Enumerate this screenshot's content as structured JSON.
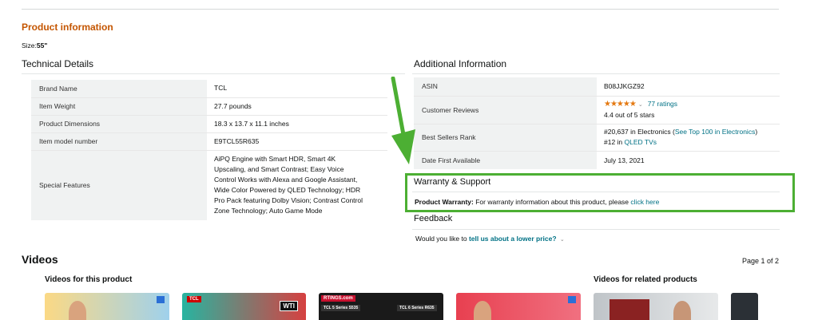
{
  "product_info": {
    "heading": "Product information",
    "size_label": "Size:",
    "size_value": "55\""
  },
  "technical_details": {
    "heading": "Technical Details",
    "rows": [
      {
        "key": "Brand Name",
        "value": "TCL"
      },
      {
        "key": "Item Weight",
        "value": "27.7 pounds"
      },
      {
        "key": "Product Dimensions",
        "value": "18.3 x 13.7 x 11.1 inches"
      },
      {
        "key": "Item model number",
        "value": "E9TCL55R635"
      },
      {
        "key": "Special Features",
        "value_lines": [
          "AiPQ Engine with Smart HDR, Smart 4K",
          "Upscaling, and Smart Contrast; Easy Voice",
          "Control Works with Alexa and Google Assistant,",
          "Wide Color Powered by QLED Technology; HDR",
          "Pro Pack featuring Dolby Vision; Contrast Control",
          "Zone Technology; Auto Game Mode"
        ]
      }
    ]
  },
  "additional_info": {
    "heading": "Additional Information",
    "asin_key": "ASIN",
    "asin_value": "B08JJKGZ92",
    "reviews_key": "Customer Reviews",
    "stars": "★★★★★",
    "rating_count": "77 ratings",
    "rating_text": "4.4 out of 5 stars",
    "rank_key": "Best Sellers Rank",
    "rank_line1_prefix": "#20,637 in Electronics (",
    "rank_line1_link": "See Top 100 in Electronics",
    "rank_line1_suffix": ")",
    "rank_line2_prefix": "#12 in",
    "rank_line2_link": "QLED TVs",
    "date_key": "Date First Available",
    "date_value": "July 13, 2021"
  },
  "warranty": {
    "heading": "Warranty & Support",
    "label": "Product Warranty:",
    "text": "For warranty information about this product, please",
    "link": "click here"
  },
  "feedback": {
    "heading": "Feedback",
    "question": "Would you like to",
    "link": "tell us about a lower price?"
  },
  "videos": {
    "heading": "Videos",
    "page": "Page 1 of 2",
    "this_product": "Videos for this product",
    "related": "Videos for related products",
    "thumb_badges": [
      "WTI",
      "RTINGS.com",
      "TCL 5 Series S535",
      "TCL 6 Series R635",
      "TCL"
    ]
  },
  "colors": {
    "accent": "#c45500",
    "link": "#007185",
    "highlight": "#4caf33",
    "stars": "#e47911"
  },
  "icons": [
    "chevron-down-icon",
    "star-rating-icon",
    "green-arrow-annotation"
  ]
}
